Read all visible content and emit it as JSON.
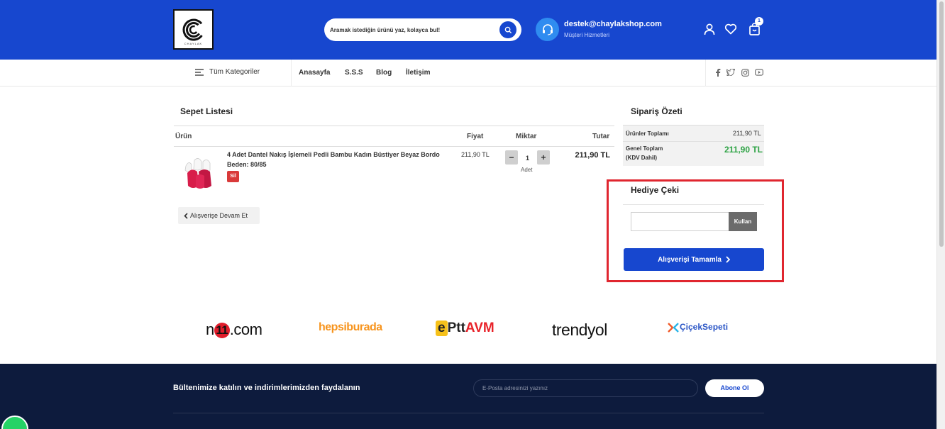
{
  "header": {
    "search_placeholder": "Aramak istediğin ürünü yaz, kolayca bul!",
    "support_email": "destek@chaylakshop.com",
    "support_label": "Müşteri Hizmetleri",
    "cart_count": "1",
    "logo_sub": "CHAYLAK"
  },
  "nav": {
    "categories": "Tüm Kategoriler",
    "links": [
      "Anasayfa",
      "S.S.S",
      "Blog",
      "İletişim"
    ]
  },
  "cart": {
    "title": "Sepet Listesi",
    "columns": {
      "product": "Ürün",
      "price": "Fiyat",
      "qty": "Miktar",
      "total": "Tutar"
    },
    "item": {
      "name": "4 Adet Dantel Nakış İşlemeli Pedli Bambu Kadın Büstiyer Beyaz Bordo",
      "size": "Beden: 80/85",
      "delete": "Sil",
      "price": "211,90 TL",
      "qty": "1",
      "unit": "Adet",
      "total": "211,90 TL"
    },
    "continue": "Alışverişe Devam Et"
  },
  "summary": {
    "title": "Sipariş Özeti",
    "products_label": "Ürünler Toplamı",
    "products_value": "211,90 TL",
    "grand_label_1": "Genel Toplam",
    "grand_label_2": "(KDV Dahil)",
    "grand_value": "211,90 TL"
  },
  "gift": {
    "title": "Hediye Çeki",
    "apply": "Kullan",
    "checkout": "Alışverişi Tamamla"
  },
  "brands": {
    "n11_a": "n",
    "n11_b": "11",
    "n11_c": ".com",
    "hb": "hepsiburada",
    "ptt_e": "e",
    "ptt": "Ptt",
    "avm": "AVM",
    "ty": "trendyol",
    "cs": "ÇiçekSepeti"
  },
  "footer": {
    "newsletter": "Bültenimize katılın ve indirimlerimizden faydalanın",
    "email_placeholder": "E-Posta adresinizi yazınız",
    "subscribe": "Abone Ol"
  },
  "colors": {
    "brand_blue": "#1747cf",
    "grand_green": "#2ea345",
    "highlight_red": "#e0262f",
    "footer_navy": "#0d1b3d"
  }
}
